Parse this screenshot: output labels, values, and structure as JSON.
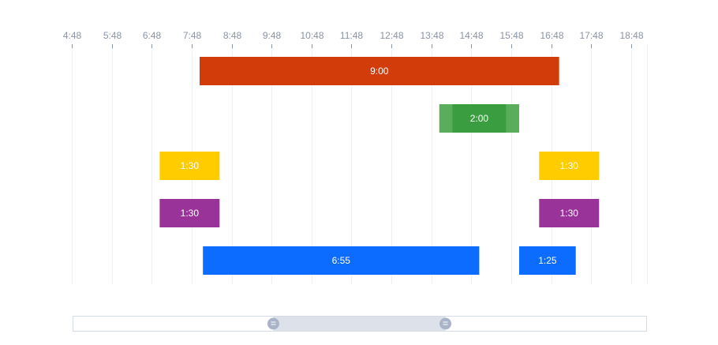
{
  "chart_data": {
    "type": "bar",
    "orientation": "horizontal-timeline",
    "x_axis": {
      "position": "top",
      "start_hours": 4.8,
      "end_hours": 19.2,
      "tick_labels": [
        "4:48",
        "5:48",
        "6:48",
        "7:48",
        "8:48",
        "9:48",
        "10:48",
        "11:48",
        "12:48",
        "13:48",
        "14:48",
        "15:48",
        "16:48",
        "17:48",
        "18:48"
      ],
      "tick_values_hours": [
        4.8,
        5.8,
        6.8,
        7.8,
        8.8,
        9.8,
        10.8,
        11.8,
        12.8,
        13.8,
        14.8,
        15.8,
        16.8,
        17.8,
        18.8
      ]
    },
    "grid": true,
    "rows": 5,
    "segments": [
      {
        "row": 0,
        "start_hours": 8.0,
        "end_hours": 17.0,
        "label": "9:00",
        "color": "#d13c0a"
      },
      {
        "row": 1,
        "start_hours": 14.0,
        "end_hours": 16.0,
        "label": "2:00",
        "color": "#5aad5a",
        "inner_start_hours": 14.33,
        "inner_end_hours": 15.67,
        "inner_color": "#3a9d3f"
      },
      {
        "row": 2,
        "start_hours": 7.0,
        "end_hours": 8.5,
        "label": "1:30",
        "color": "#ffcc00"
      },
      {
        "row": 2,
        "start_hours": 16.5,
        "end_hours": 18.0,
        "label": "1:30",
        "color": "#ffcc00"
      },
      {
        "row": 3,
        "start_hours": 7.0,
        "end_hours": 8.5,
        "label": "1:30",
        "color": "#993399"
      },
      {
        "row": 3,
        "start_hours": 16.5,
        "end_hours": 18.0,
        "label": "1:30",
        "color": "#993399"
      },
      {
        "row": 4,
        "start_hours": 8.083,
        "end_hours": 15.0,
        "label": "6:55",
        "color": "#0b6cff"
      },
      {
        "row": 4,
        "start_hours": 16.0,
        "end_hours": 17.417,
        "label": "1:25",
        "color": "#0b6cff"
      }
    ],
    "data_zoom": {
      "start_fraction": 0.35,
      "end_fraction": 0.65,
      "border_color": "#d2dbe6",
      "fill_color": "#dde2ea",
      "handle_color": "#aab4c8"
    }
  }
}
